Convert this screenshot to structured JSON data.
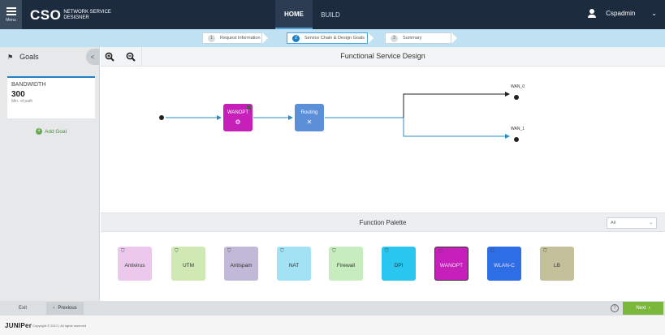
{
  "header": {
    "menu_label": "Menu",
    "brand_main": "CSO",
    "brand_sub": "NETWORK SERVICE DESIGNER",
    "nav_home": "HOME",
    "nav_build": "BUILD",
    "user_name": "Cspadmin",
    "caret": "⌄"
  },
  "stepper": {
    "steps": [
      {
        "num": "1",
        "label": "Request Information"
      },
      {
        "num": "2",
        "label": "Service Chain & Design Goals"
      },
      {
        "num": "3",
        "label": "Summary"
      }
    ]
  },
  "sidebar": {
    "title": "Goals",
    "collapse": "<",
    "goal": {
      "title": "BANDWIDTH",
      "value": "300",
      "sub": "Min. of path"
    },
    "add_goal": "Add Goal"
  },
  "canvas": {
    "title": "Functional Service Design",
    "nodes": [
      {
        "label": "WANOPT",
        "icon": "gear-icon"
      },
      {
        "label": "Routing",
        "icon": "arrows-icon"
      }
    ],
    "endpoints": [
      "WAN_0",
      "WAN_1"
    ]
  },
  "palette": {
    "title": "Function Palette",
    "filter": "All",
    "items": [
      {
        "label": "Antivirus",
        "color": "#ecc8ec"
      },
      {
        "label": "UTM",
        "color": "#cfe8b4"
      },
      {
        "label": "Antispam",
        "color": "#c2b8d8"
      },
      {
        "label": "NAT",
        "color": "#a3e2f4"
      },
      {
        "label": "Firewall",
        "color": "#c7edbf"
      },
      {
        "label": "DPI",
        "color": "#29c7ef"
      },
      {
        "label": "WANOPT",
        "color": "#c61fba"
      },
      {
        "label": "WLAN-C",
        "color": "#2d6ee6"
      },
      {
        "label": "LB",
        "color": "#c4c09a"
      }
    ]
  },
  "footer": {
    "exit": "Exit",
    "previous": "Previous",
    "help": "?",
    "next": "Next",
    "logo": "JUNIPer",
    "copyright": "Copyright © 2017 | All rights reserved"
  }
}
